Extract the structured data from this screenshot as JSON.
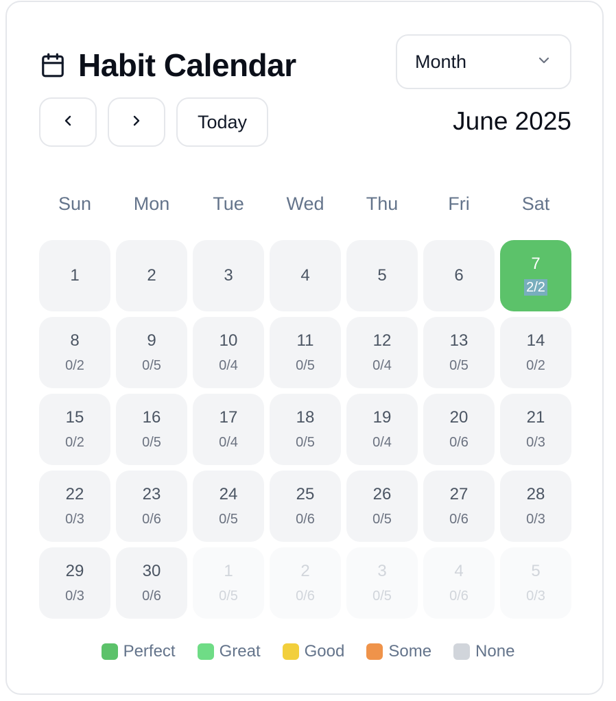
{
  "header": {
    "title": "Habit Calendar",
    "icon": "calendar-icon"
  },
  "view_select": {
    "value": "Month",
    "icon": "chevron-down-icon"
  },
  "nav": {
    "prev_icon": "chevron-left-icon",
    "next_icon": "chevron-right-icon",
    "today_label": "Today"
  },
  "month_label": "June 2025",
  "weekdays": [
    "Sun",
    "Mon",
    "Tue",
    "Wed",
    "Thu",
    "Fri",
    "Sat"
  ],
  "days": [
    {
      "num": "1",
      "count": "",
      "status": "none",
      "current_month": true
    },
    {
      "num": "2",
      "count": "",
      "status": "none",
      "current_month": true
    },
    {
      "num": "3",
      "count": "",
      "status": "none",
      "current_month": true
    },
    {
      "num": "4",
      "count": "",
      "status": "none",
      "current_month": true
    },
    {
      "num": "5",
      "count": "",
      "status": "none",
      "current_month": true
    },
    {
      "num": "6",
      "count": "",
      "status": "none",
      "current_month": true
    },
    {
      "num": "7",
      "count": "2/2",
      "status": "perfect",
      "current_month": true
    },
    {
      "num": "8",
      "count": "0/2",
      "status": "none",
      "current_month": true
    },
    {
      "num": "9",
      "count": "0/5",
      "status": "none",
      "current_month": true
    },
    {
      "num": "10",
      "count": "0/4",
      "status": "none",
      "current_month": true
    },
    {
      "num": "11",
      "count": "0/5",
      "status": "none",
      "current_month": true
    },
    {
      "num": "12",
      "count": "0/4",
      "status": "none",
      "current_month": true
    },
    {
      "num": "13",
      "count": "0/5",
      "status": "none",
      "current_month": true
    },
    {
      "num": "14",
      "count": "0/2",
      "status": "none",
      "current_month": true
    },
    {
      "num": "15",
      "count": "0/2",
      "status": "none",
      "current_month": true
    },
    {
      "num": "16",
      "count": "0/5",
      "status": "none",
      "current_month": true
    },
    {
      "num": "17",
      "count": "0/4",
      "status": "none",
      "current_month": true
    },
    {
      "num": "18",
      "count": "0/5",
      "status": "none",
      "current_month": true
    },
    {
      "num": "19",
      "count": "0/4",
      "status": "none",
      "current_month": true
    },
    {
      "num": "20",
      "count": "0/6",
      "status": "none",
      "current_month": true
    },
    {
      "num": "21",
      "count": "0/3",
      "status": "none",
      "current_month": true
    },
    {
      "num": "22",
      "count": "0/3",
      "status": "none",
      "current_month": true
    },
    {
      "num": "23",
      "count": "0/6",
      "status": "none",
      "current_month": true
    },
    {
      "num": "24",
      "count": "0/5",
      "status": "none",
      "current_month": true
    },
    {
      "num": "25",
      "count": "0/6",
      "status": "none",
      "current_month": true
    },
    {
      "num": "26",
      "count": "0/5",
      "status": "none",
      "current_month": true
    },
    {
      "num": "27",
      "count": "0/6",
      "status": "none",
      "current_month": true
    },
    {
      "num": "28",
      "count": "0/3",
      "status": "none",
      "current_month": true
    },
    {
      "num": "29",
      "count": "0/3",
      "status": "none",
      "current_month": true
    },
    {
      "num": "30",
      "count": "0/6",
      "status": "none",
      "current_month": true
    },
    {
      "num": "1",
      "count": "0/5",
      "status": "none",
      "current_month": false
    },
    {
      "num": "2",
      "count": "0/6",
      "status": "none",
      "current_month": false
    },
    {
      "num": "3",
      "count": "0/5",
      "status": "none",
      "current_month": false
    },
    {
      "num": "4",
      "count": "0/6",
      "status": "none",
      "current_month": false
    },
    {
      "num": "5",
      "count": "0/3",
      "status": "none",
      "current_month": false
    }
  ],
  "legend": [
    {
      "label": "Perfect",
      "color": "#5cc26a"
    },
    {
      "label": "Great",
      "color": "#6fdc86"
    },
    {
      "label": "Good",
      "color": "#f2cf3c"
    },
    {
      "label": "Some",
      "color": "#ef934a"
    },
    {
      "label": "None",
      "color": "#d1d5db"
    }
  ]
}
